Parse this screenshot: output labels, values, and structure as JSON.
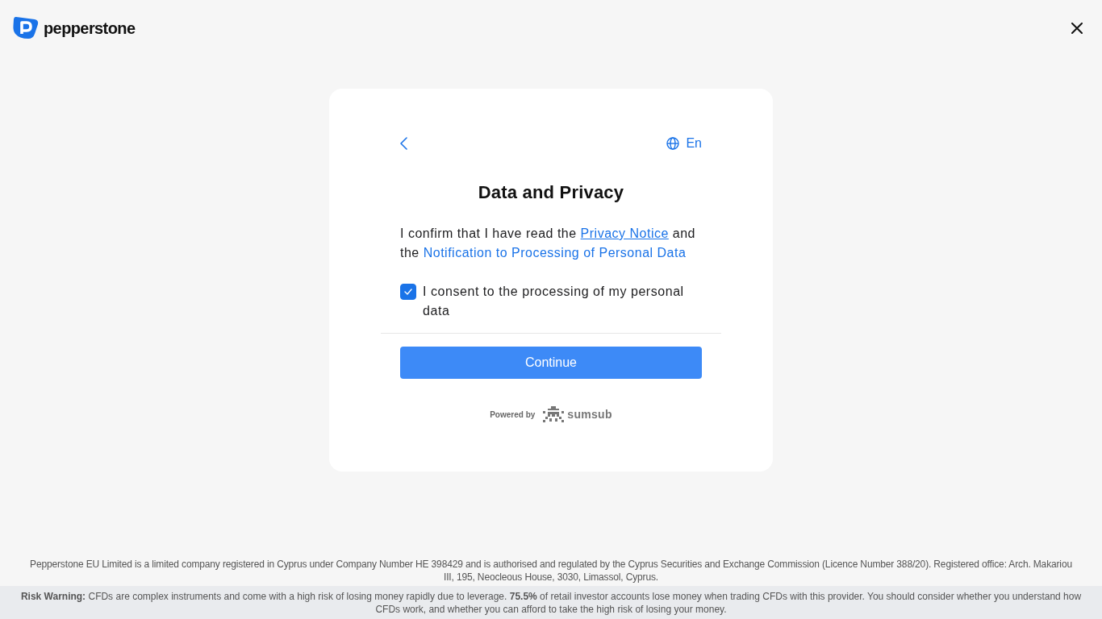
{
  "header": {
    "brand": "pepperstone"
  },
  "card": {
    "language": "En",
    "title": "Data and Privacy",
    "intro": [
      {
        "kind": "text",
        "text": "I confirm that I have read the "
      },
      {
        "kind": "link",
        "text": "Privacy Notice",
        "underlined": true
      },
      {
        "kind": "text",
        "text": " and the "
      },
      {
        "kind": "link",
        "text": "Notification to Processing of Personal Data",
        "underlined": false
      }
    ],
    "consent": {
      "label": "I consent to the processing of my personal data",
      "checked": true
    },
    "continue_button": "Continue",
    "powered_by": {
      "label": "Powered by",
      "brand": "sumsub"
    }
  },
  "footer": {
    "legal": "Pepperstone EU Limited is a limited company registered in Cyprus under Company Number HE 398429 and is authorised and regulated by the Cyprus Securities and Exchange Commission (Licence Number 388/20). Registered office: Arch. Makariou III, 195, Neocleous House, 3030, Limassol, Cyprus.",
    "risk_warning": "**Risk Warning:** CFDs are complex instruments and come with a high risk of losing money rapidly due to leverage. **75.5%** of retail investor accounts lose money when trading CFDs with this provider. You should consider whether you understand how CFDs work, and whether you can afford to take the high risk of losing your money."
  }
}
